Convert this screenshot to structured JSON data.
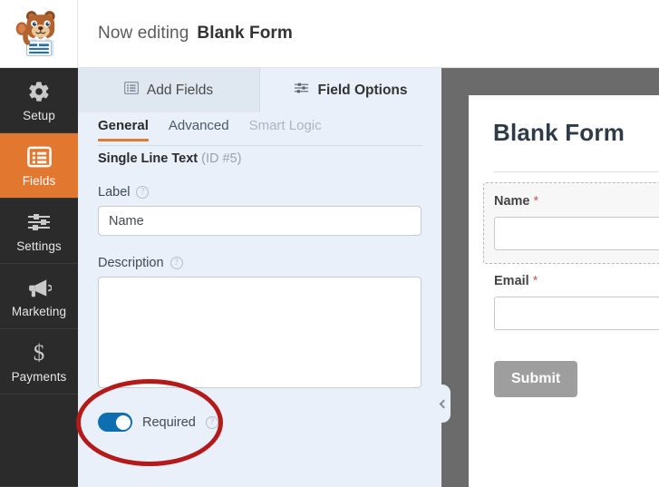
{
  "header": {
    "editing_prefix": "Now editing",
    "form_title": "Blank Form",
    "logo_icon": "wpforms-bear-mascot-logo"
  },
  "sidebar": {
    "items": [
      {
        "label": "Setup",
        "icon": "gear-icon",
        "active": false
      },
      {
        "label": "Fields",
        "icon": "list-form-icon",
        "active": true
      },
      {
        "label": "Settings",
        "icon": "sliders-icon",
        "active": false
      },
      {
        "label": "Marketing",
        "icon": "megaphone-icon",
        "active": false
      },
      {
        "label": "Payments",
        "icon": "dollar-icon",
        "active": false
      }
    ],
    "accent_color": "#e27730",
    "background_color": "#2b2b2b"
  },
  "panel": {
    "tabs": [
      {
        "label": "Add Fields",
        "icon": "fields-grid-icon",
        "active": false
      },
      {
        "label": "Field Options",
        "icon": "sliders-icon",
        "active": true
      }
    ],
    "subtabs": [
      {
        "label": "General",
        "active": true,
        "muted": false
      },
      {
        "label": "Advanced",
        "active": false,
        "muted": false
      },
      {
        "label": "Smart Logic",
        "active": false,
        "muted": true
      }
    ],
    "field_type": "Single Line Text",
    "field_id": "(ID #5)",
    "label_option": {
      "label": "Label",
      "help_icon": "question-mark-icon",
      "value": "Name",
      "placeholder": ""
    },
    "description_option": {
      "label": "Description",
      "help_icon": "question-mark-icon",
      "value": "",
      "placeholder": ""
    },
    "required_option": {
      "label": "Required",
      "help_icon": "question-mark-icon",
      "enabled": true,
      "toggle_color": "#0d6fb0"
    },
    "collapse_icon": "chevron-left-icon",
    "background_color": "#e9f0fa"
  },
  "preview": {
    "form_title": "Blank Form",
    "fields": [
      {
        "label": "Name",
        "required_marker": "*",
        "selected": true
      },
      {
        "label": "Email",
        "required_marker": "*",
        "selected": false
      }
    ],
    "submit_label": "Submit",
    "backdrop_color": "#6b6b6b"
  },
  "annotation": {
    "shape": "ellipse-highlight",
    "color": "#b51a1a",
    "targets": "required-toggle"
  }
}
